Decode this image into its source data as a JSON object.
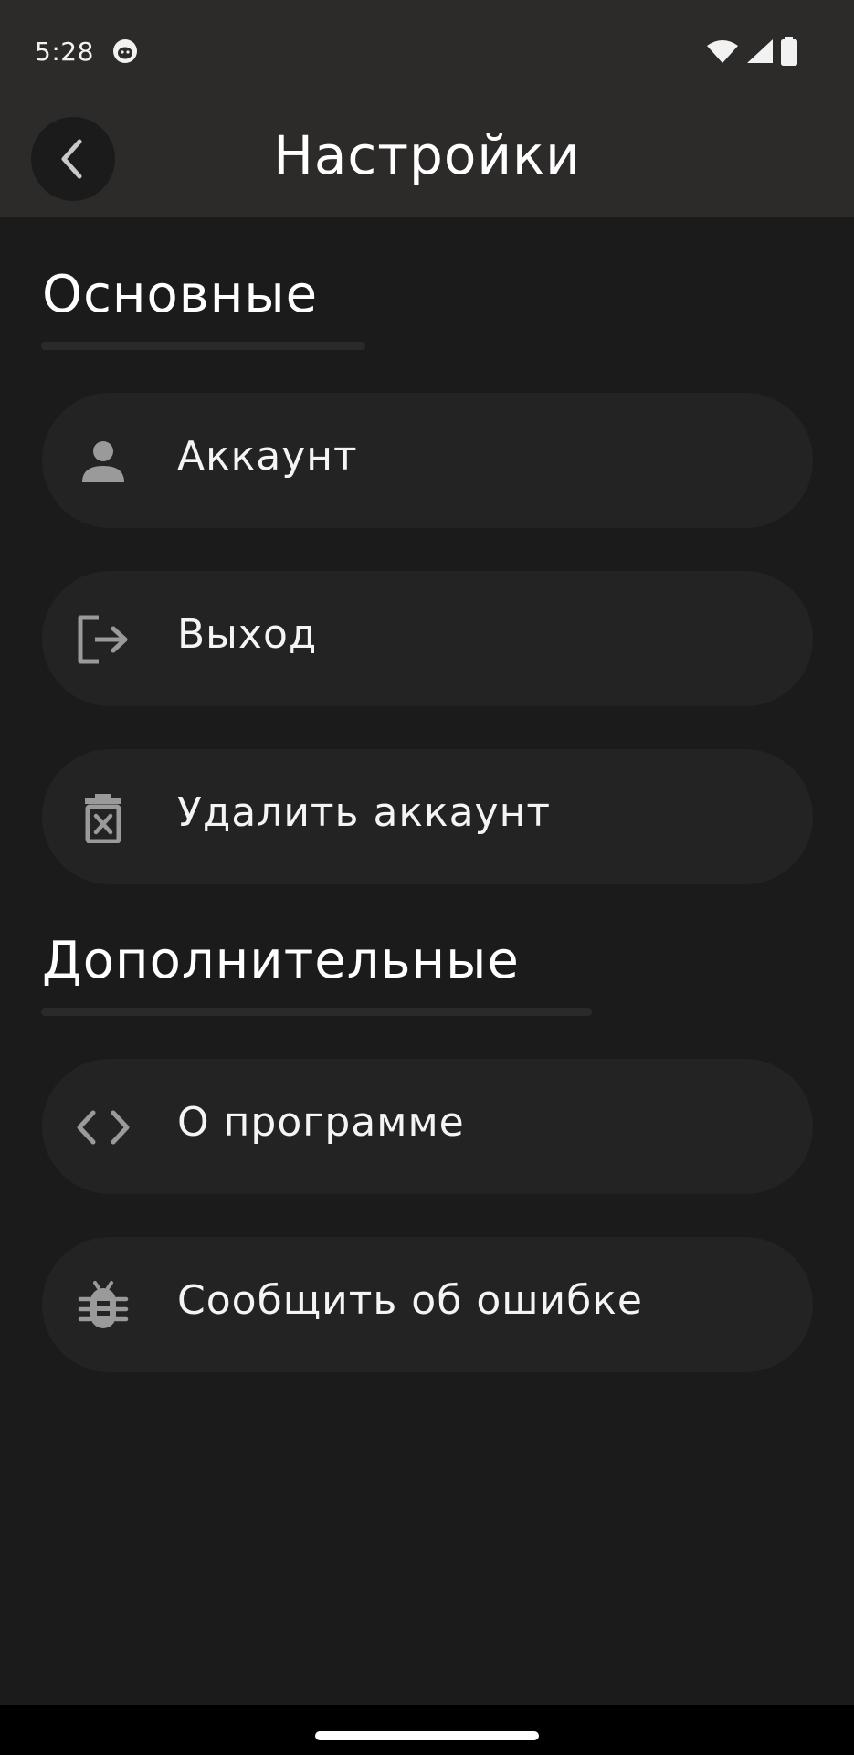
{
  "status_bar": {
    "time": "5:28",
    "icons": [
      "cat-app-icon",
      "wifi-icon",
      "cell-signal-icon",
      "battery-icon"
    ]
  },
  "app_bar": {
    "title": "Настройки",
    "back_icon": "chevron-left-icon"
  },
  "sections": [
    {
      "title": "Основные",
      "items": [
        {
          "label": "Аккаунт",
          "icon": "person-icon"
        },
        {
          "label": "Выход",
          "icon": "logout-icon"
        },
        {
          "label": "Удалить аккаунт",
          "icon": "trash-x-icon"
        }
      ]
    },
    {
      "title": "Дополнительные",
      "items": [
        {
          "label": "О программе",
          "icon": "code-icon"
        },
        {
          "label": "Сообщить об ошибке",
          "icon": "bug-icon"
        }
      ]
    }
  ],
  "colors": {
    "background": "#1b1b1b",
    "app_bar": "#2c2b2a",
    "card": "#232323",
    "icon": "#9a9a9a",
    "text": "#f4f4f4"
  }
}
